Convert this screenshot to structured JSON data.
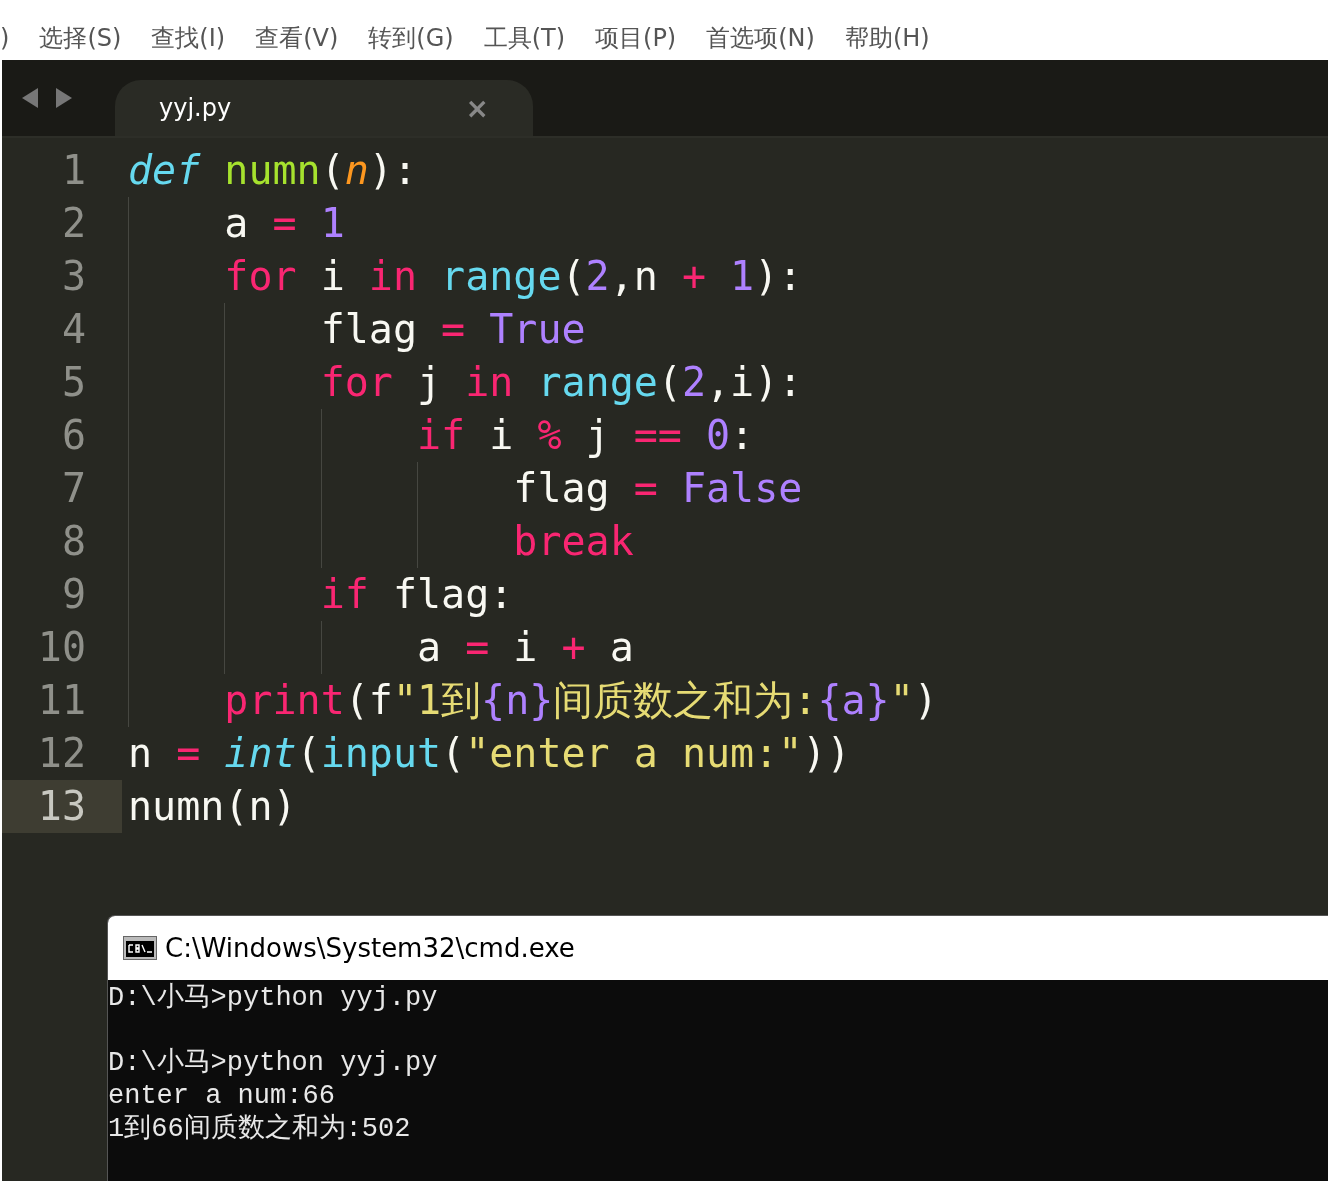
{
  "menu": [
    ")",
    "选择(S)",
    "查找(I)",
    "查看(V)",
    "转到(G)",
    "工具(T)",
    "项目(P)",
    "首选项(N)",
    "帮助(H)"
  ],
  "tabs": [
    {
      "label": "yyj.py",
      "close": "×",
      "selected": true
    }
  ],
  "editor": {
    "lines": [
      {
        "number": "1",
        "current": false,
        "code": [
          {
            "text": "def",
            "kind": "storage"
          },
          {
            "text": " numn",
            "kind": "func"
          },
          {
            "text": "(",
            "kind": "plain"
          },
          {
            "text": "n",
            "kind": "param"
          },
          {
            "text": "):",
            "kind": "plain"
          }
        ],
        "children": [
          {
            "number": "2",
            "current": false,
            "code": [
              {
                "text": "a ",
                "kind": "plain"
              },
              {
                "text": "= ",
                "kind": "op"
              },
              {
                "text": "1",
                "kind": "num"
              }
            ]
          },
          {
            "number": "3",
            "current": false,
            "code": [
              {
                "text": "for",
                "kind": "kw"
              },
              {
                "text": " i ",
                "kind": "plain"
              },
              {
                "text": "in",
                "kind": "kw"
              },
              {
                "text": " range",
                "kind": "builtin"
              },
              {
                "text": "(",
                "kind": "plain"
              },
              {
                "text": "2",
                "kind": "num"
              },
              {
                "text": ",n ",
                "kind": "plain"
              },
              {
                "text": "+ ",
                "kind": "op"
              },
              {
                "text": "1",
                "kind": "num"
              },
              {
                "text": "):",
                "kind": "plain"
              }
            ],
            "children": [
              {
                "number": "4",
                "current": false,
                "code": [
                  {
                    "text": "flag ",
                    "kind": "plain"
                  },
                  {
                    "text": "= ",
                    "kind": "op"
                  },
                  {
                    "text": "True",
                    "kind": "num"
                  }
                ]
              },
              {
                "number": "5",
                "current": false,
                "code": [
                  {
                    "text": "for",
                    "kind": "kw"
                  },
                  {
                    "text": " j ",
                    "kind": "plain"
                  },
                  {
                    "text": "in",
                    "kind": "kw"
                  },
                  {
                    "text": " range",
                    "kind": "builtin"
                  },
                  {
                    "text": "(",
                    "kind": "plain"
                  },
                  {
                    "text": "2",
                    "kind": "num"
                  },
                  {
                    "text": ",i):",
                    "kind": "plain"
                  }
                ],
                "children": [
                  {
                    "number": "6",
                    "current": false,
                    "code": [
                      {
                        "text": "if",
                        "kind": "kw"
                      },
                      {
                        "text": " i ",
                        "kind": "plain"
                      },
                      {
                        "text": "% ",
                        "kind": "op"
                      },
                      {
                        "text": "j ",
                        "kind": "plain"
                      },
                      {
                        "text": "== ",
                        "kind": "op"
                      },
                      {
                        "text": "0",
                        "kind": "num"
                      },
                      {
                        "text": ":",
                        "kind": "plain"
                      }
                    ],
                    "children": [
                      {
                        "number": "7",
                        "current": false,
                        "code": [
                          {
                            "text": "flag ",
                            "kind": "plain"
                          },
                          {
                            "text": "= ",
                            "kind": "op"
                          },
                          {
                            "text": "False",
                            "kind": "num"
                          }
                        ]
                      },
                      {
                        "number": "8",
                        "current": false,
                        "code": [
                          {
                            "text": "break",
                            "kind": "kw"
                          }
                        ]
                      }
                    ]
                  }
                ]
              },
              {
                "number": "9",
                "current": false,
                "code": [
                  {
                    "text": "if",
                    "kind": "kw"
                  },
                  {
                    "text": " flag:",
                    "kind": "plain"
                  }
                ],
                "children": [
                  {
                    "number": "10",
                    "current": false,
                    "code": [
                      {
                        "text": "a ",
                        "kind": "plain"
                      },
                      {
                        "text": "= ",
                        "kind": "op"
                      },
                      {
                        "text": "i ",
                        "kind": "plain"
                      },
                      {
                        "text": "+ ",
                        "kind": "op"
                      },
                      {
                        "text": "a",
                        "kind": "plain"
                      }
                    ]
                  }
                ]
              }
            ]
          },
          {
            "number": "11",
            "current": false,
            "code": [
              {
                "text": "print",
                "kind": "kw"
              },
              {
                "text": "(f",
                "kind": "plain"
              },
              {
                "text": "\"1到",
                "kind": "str"
              },
              {
                "text": "{n}",
                "kind": "num"
              },
              {
                "text": "间质数之和为:",
                "kind": "str"
              },
              {
                "text": "{a}",
                "kind": "num"
              },
              {
                "text": "\"",
                "kind": "str"
              },
              {
                "text": ")",
                "kind": "plain"
              }
            ]
          }
        ]
      },
      {
        "number": "12",
        "current": false,
        "code": [
          {
            "text": "n ",
            "kind": "plain"
          },
          {
            "text": "= ",
            "kind": "op"
          },
          {
            "text": "int",
            "kind": "storage"
          },
          {
            "text": "(",
            "kind": "plain"
          },
          {
            "text": "input",
            "kind": "builtin"
          },
          {
            "text": "(",
            "kind": "plain"
          },
          {
            "text": "\"enter a num:\"",
            "kind": "str"
          },
          {
            "text": "))",
            "kind": "plain"
          }
        ]
      },
      {
        "number": "13",
        "current": true,
        "code": [
          {
            "text": "numn(n)",
            "kind": "plain"
          }
        ]
      }
    ]
  },
  "console": {
    "title": "C:\\Windows\\System32\\cmd.exe",
    "blocks": [
      [
        "D:\\小马>python yyj.py"
      ],
      [
        "D:\\小马>python yyj.py",
        "enter a num:66",
        "1到66间质数之和为:502"
      ]
    ]
  }
}
